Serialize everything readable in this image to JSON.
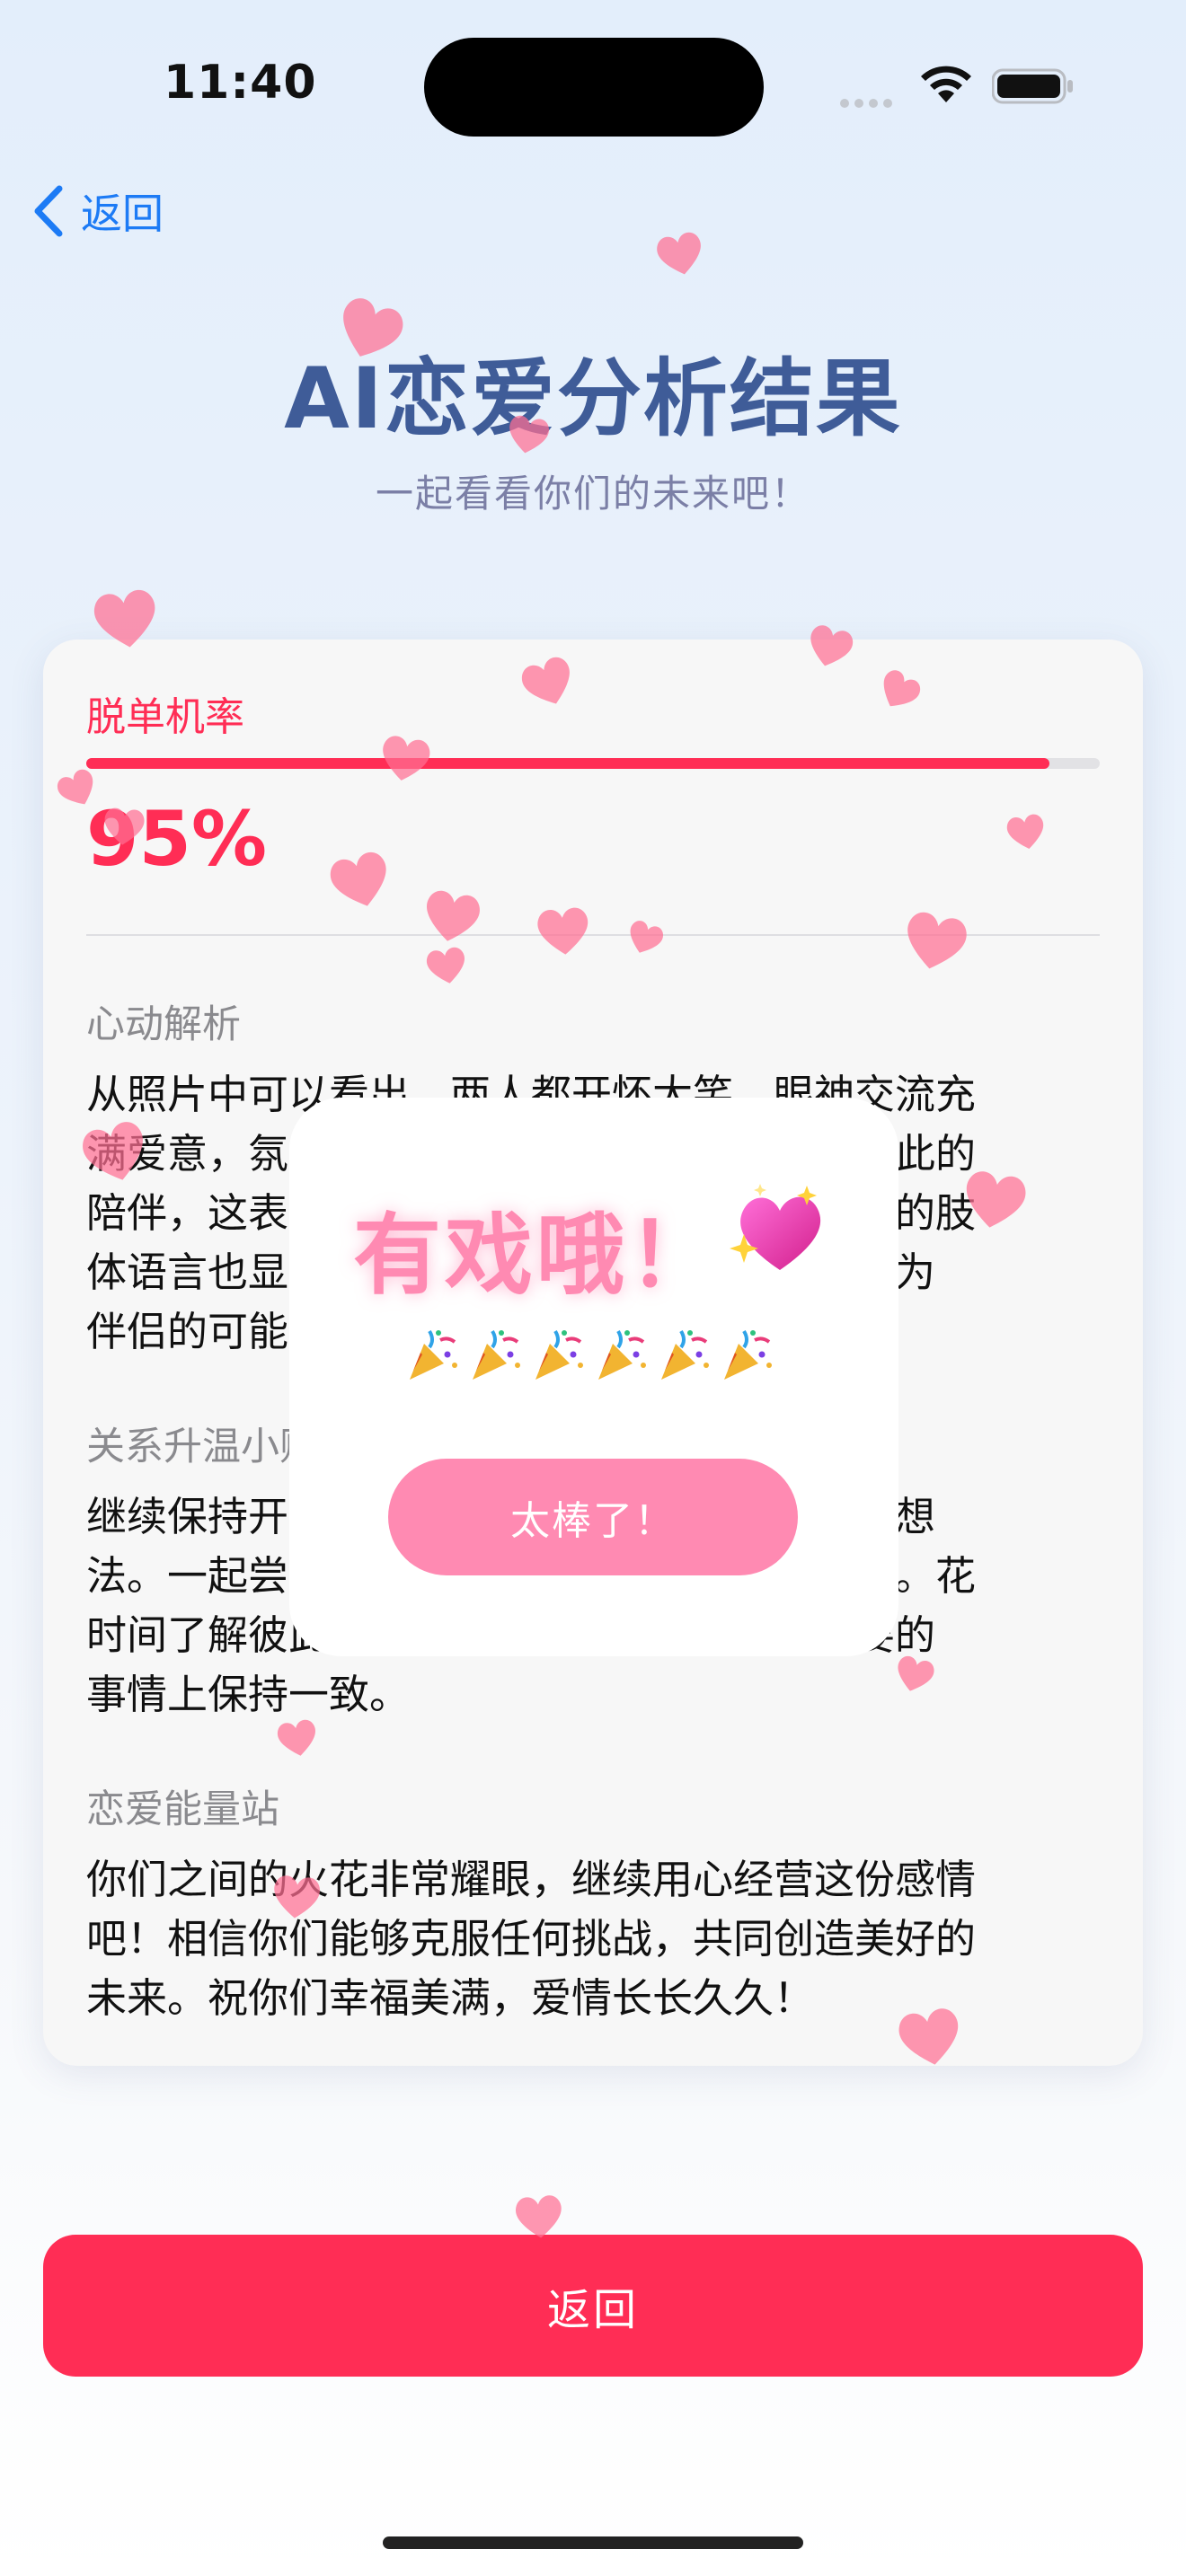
{
  "status_bar": {
    "time": "11:40"
  },
  "nav": {
    "back_label": "返回"
  },
  "header": {
    "title": "AI恋爱分析结果",
    "subtitle": "一起看看你们的未来吧！"
  },
  "result_card": {
    "stat_label": "脱单机率",
    "stat_value": "95%",
    "progress": 0.95,
    "sections": [
      {
        "title": "心动解析",
        "lines": [
          "从照片中可以看出，两人都开怀大笑，眼神交流充",
          "满爱意，氛围非常轻松愉悦，似乎都很享受彼此的",
          "陪伴，这表明你们之间有着很好的默契。他们的肢",
          "体语言也显示出亲密和信任，这增加了他们成为",
          "伴侣的可能性。"
        ]
      },
      {
        "title": "关系升温小贴士",
        "lines": [
          "继续保持开放的沟通，分享彼此的真实感受和想",
          "法。一起尝试新鲜事物，创造更多美好的回忆。花",
          "时间了解彼此的兴趣爱好，并确保你们在重要的",
          "事情上保持一致。"
        ]
      },
      {
        "title": "恋爱能量站",
        "lines": [
          "你们之间的火花非常耀眼，继续用心经营这份感情",
          "吧！相信你们能够克服任何挑战，共同创造美好的",
          "未来。祝你们幸福美满，爱情长长久久！"
        ]
      }
    ]
  },
  "popup": {
    "title": "有戏哦！",
    "emoji_icon": "sparkling-heart-icon",
    "confetti_icon": "party-popper-icon",
    "confetti_count": 6,
    "button_label": "太棒了！"
  },
  "footer": {
    "button_label": "返回"
  },
  "colors": {
    "accent": "#ff2d55",
    "popup_pink": "#ff8ab2",
    "title_blue": "#3f5c98",
    "link_blue": "#1d7bf5"
  }
}
